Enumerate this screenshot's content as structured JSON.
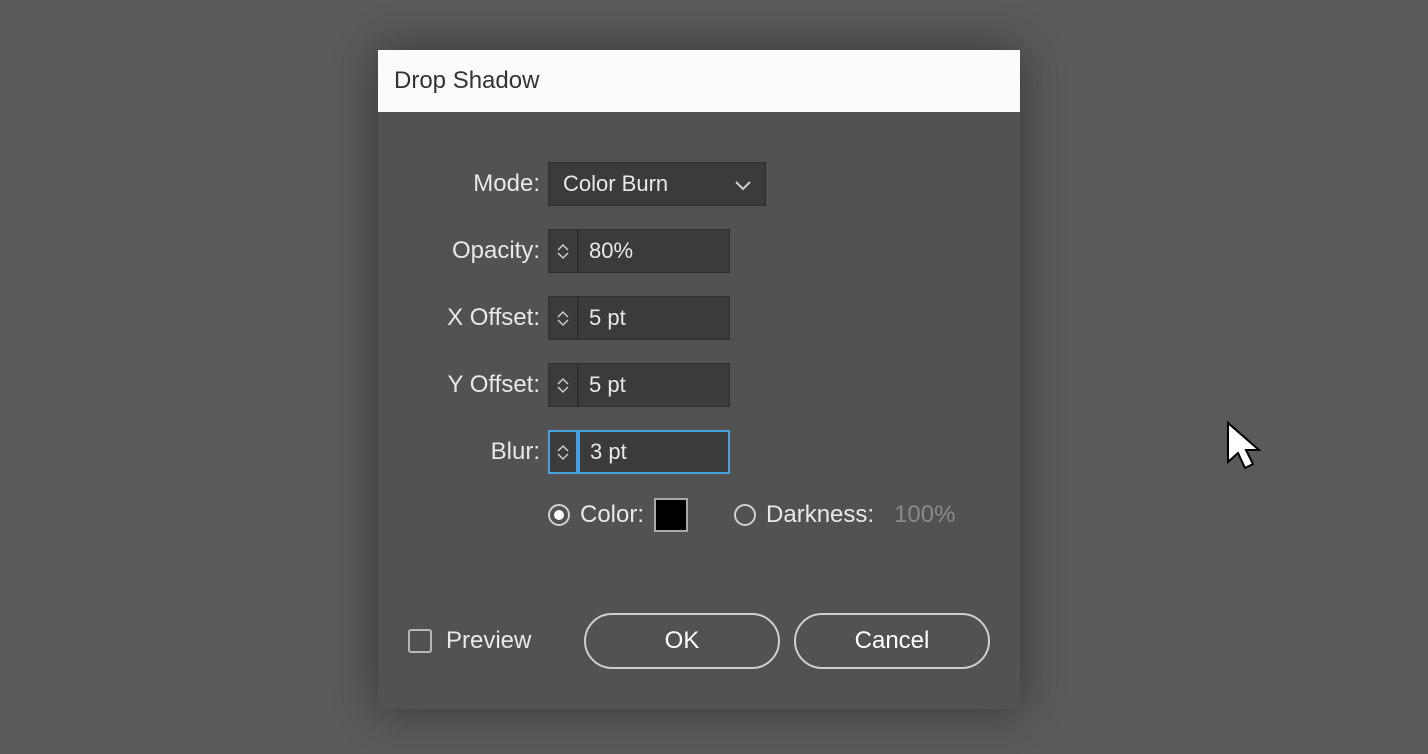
{
  "dialog": {
    "title": "Drop Shadow",
    "fields": {
      "mode": {
        "label": "Mode:",
        "value": "Color Burn"
      },
      "opacity": {
        "label": "Opacity:",
        "value": "80%"
      },
      "x_offset": {
        "label": "X Offset:",
        "value": "5 pt"
      },
      "y_offset": {
        "label": "Y Offset:",
        "value": "5 pt"
      },
      "blur": {
        "label": "Blur:",
        "value": "3 pt"
      }
    },
    "color_row": {
      "color_label": "Color:",
      "color_swatch": "#000000",
      "darkness_label": "Darkness:",
      "darkness_value": "100%",
      "selected": "color"
    },
    "preview_label": "Preview",
    "preview_checked": false,
    "ok_label": "OK",
    "cancel_label": "Cancel"
  }
}
